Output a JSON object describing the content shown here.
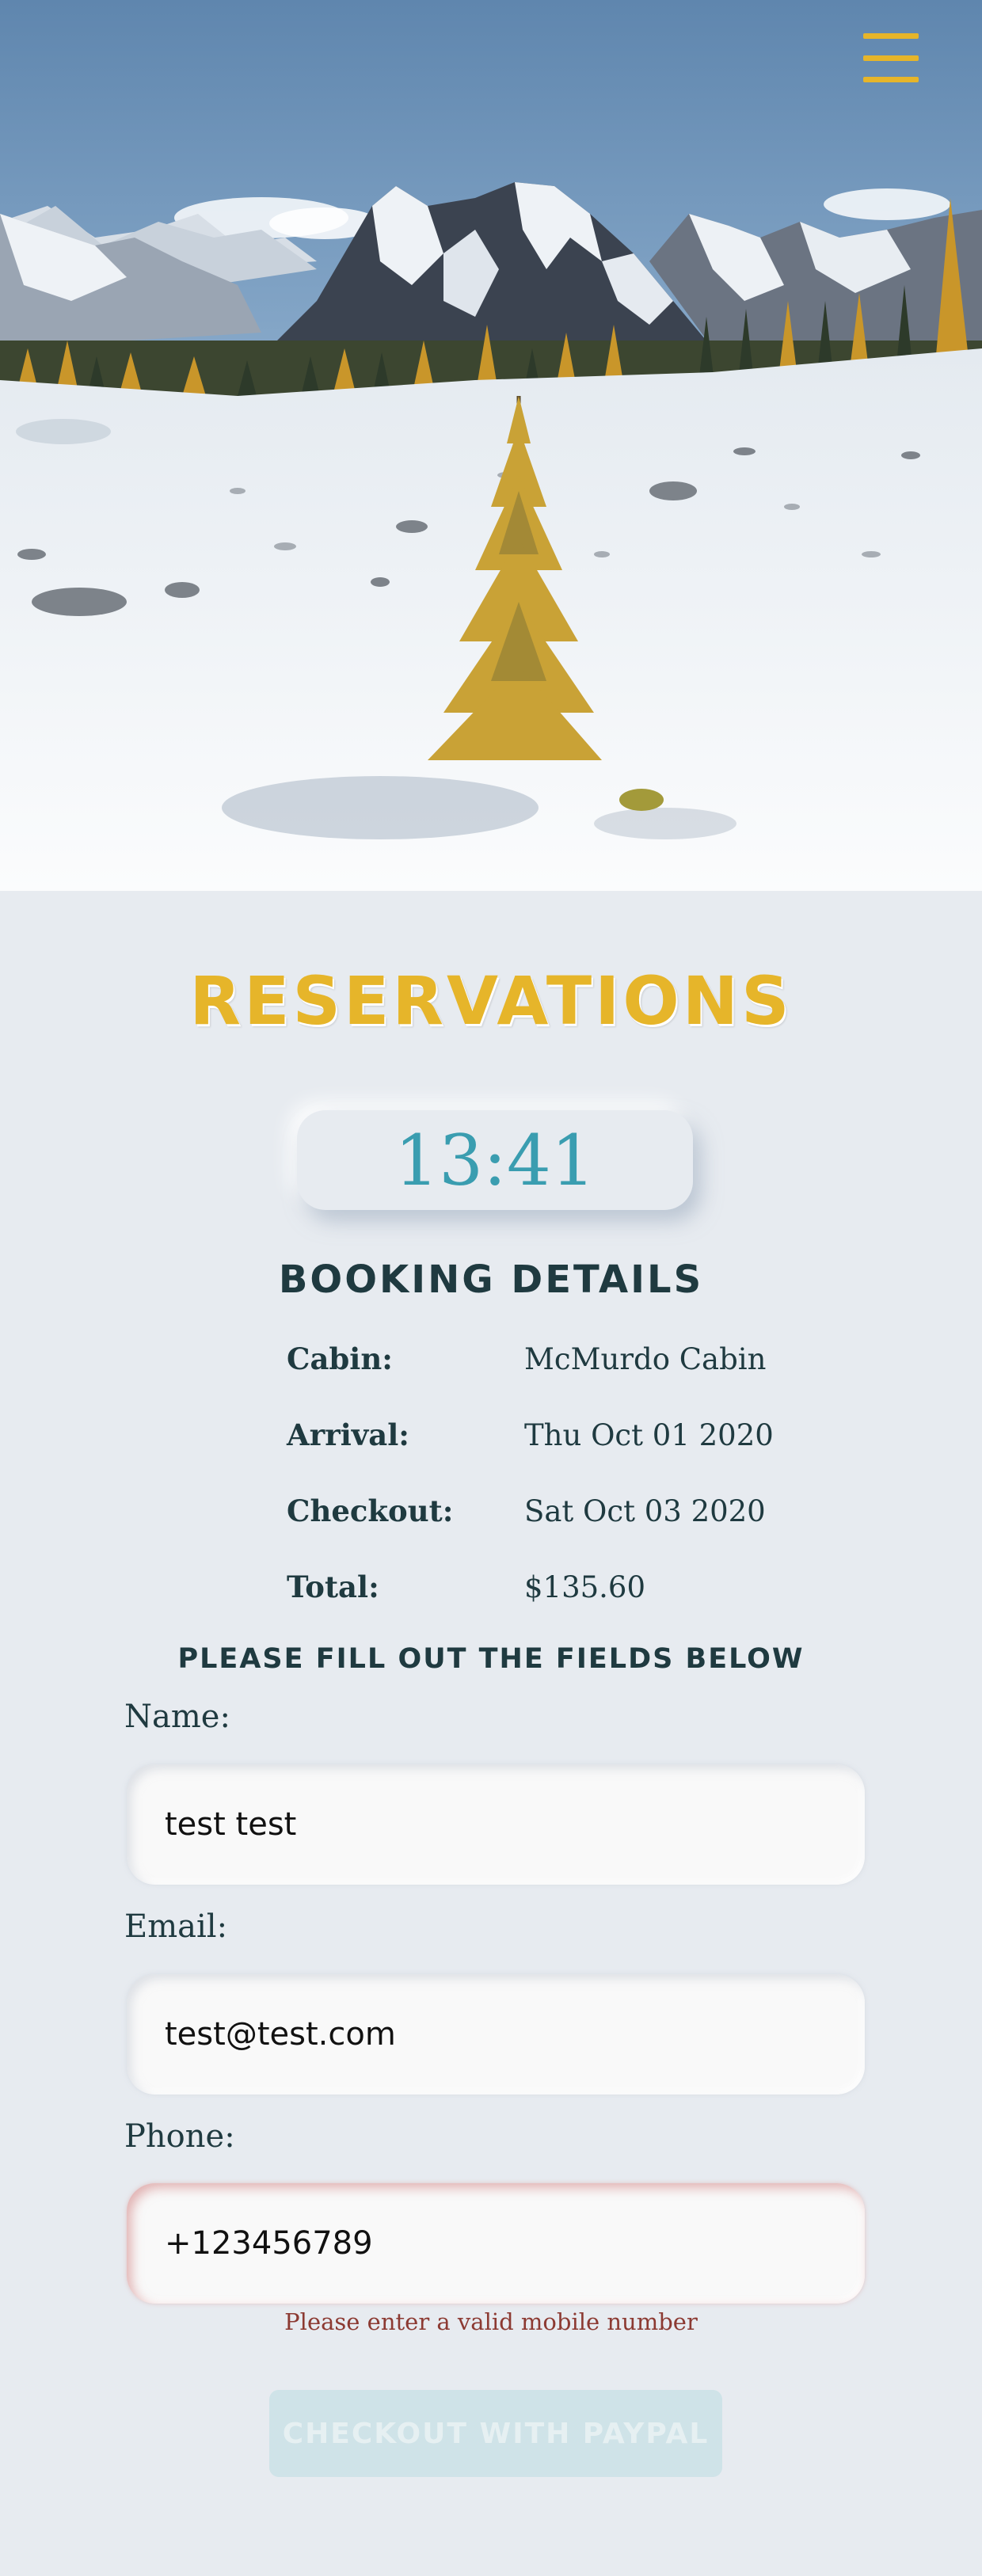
{
  "header": {
    "menu_icon": "hamburger-menu-icon",
    "hero_image": "snowy-mountain-landscape"
  },
  "page": {
    "title": "RESERVATIONS",
    "timer": "13:41"
  },
  "booking": {
    "heading": "BOOKING DETAILS",
    "rows": [
      {
        "label": "Cabin:",
        "value": "McMurdo Cabin"
      },
      {
        "label": "Arrival:",
        "value": "Thu Oct 01 2020"
      },
      {
        "label": "Checkout:",
        "value": "Sat Oct 03 2020"
      },
      {
        "label": "Total:",
        "value": "$135.60"
      }
    ]
  },
  "form": {
    "heading": "PLEASE FILL OUT THE FIELDS BELOW",
    "name": {
      "label": "Name:",
      "value": "test test"
    },
    "email": {
      "label": "Email:",
      "value": "test@test.com"
    },
    "phone": {
      "label": "Phone:",
      "value": "+123456789",
      "error": "Please enter a valid mobile number"
    },
    "submit_label": "CHECKOUT WITH PAYPAL"
  },
  "colors": {
    "accent": "#e6b52a",
    "timer": "#3a9db0",
    "heading": "#1f3a40",
    "background": "#e7ebf0",
    "error": "#8c3a32",
    "button_disabled": "#cfe3e8"
  }
}
